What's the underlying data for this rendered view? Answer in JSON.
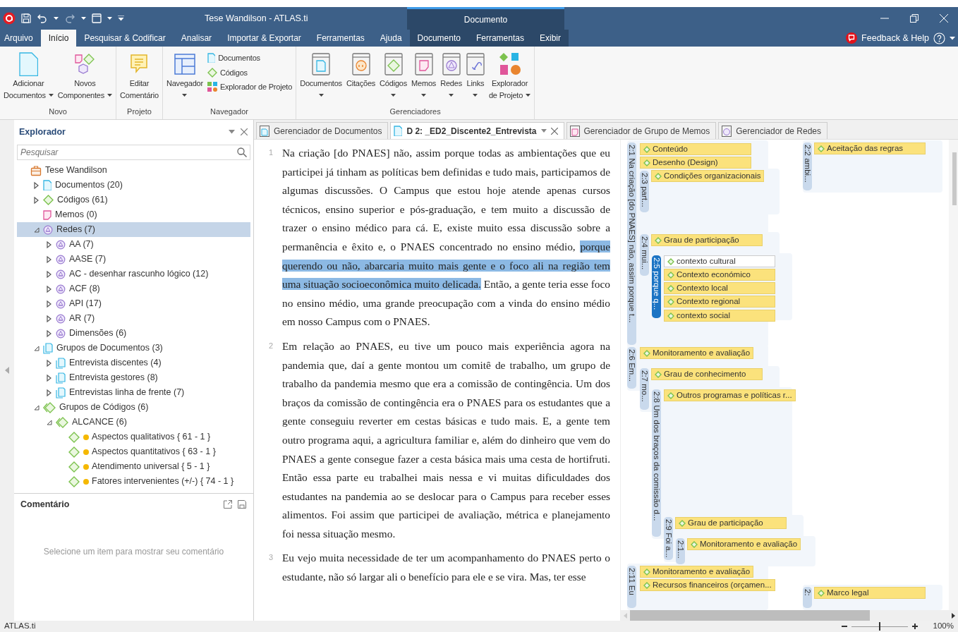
{
  "window": {
    "title": "Tese Wandilson - ATLAS.ti",
    "context_title": "Documento"
  },
  "menu_tabs": [
    {
      "label": "Arquivo",
      "selected": false,
      "context": false
    },
    {
      "label": "Início",
      "selected": true,
      "context": false
    },
    {
      "label": "Pesquisar & Codificar",
      "selected": false,
      "context": false
    },
    {
      "label": "Analisar",
      "selected": false,
      "context": false
    },
    {
      "label": "Importar & Exportar",
      "selected": false,
      "context": false
    },
    {
      "label": "Ferramentas",
      "selected": false,
      "context": false
    },
    {
      "label": "Ajuda",
      "selected": false,
      "context": false
    },
    {
      "label": "Documento",
      "selected": false,
      "context": true
    },
    {
      "label": "Ferramentas",
      "selected": false,
      "context": true
    },
    {
      "label": "Exibir",
      "selected": false,
      "context": true
    }
  ],
  "feedback": "Feedback & Help",
  "ribbon": {
    "groups": [
      {
        "label": "Novo",
        "buttons": [
          {
            "kind": "large",
            "lines": [
              "Adicionar",
              "Documentos"
            ],
            "dropdown": true
          },
          {
            "kind": "large",
            "lines": [
              "Novos",
              "Componentes"
            ],
            "dropdown": true
          }
        ]
      },
      {
        "label": "Projeto",
        "buttons": [
          {
            "kind": "large",
            "lines": [
              "Editar",
              "Comentário"
            ],
            "dropdown": false
          }
        ]
      },
      {
        "label": "Navegador",
        "buttons": [
          {
            "kind": "large",
            "lines": [
              "Navegador"
            ],
            "dropdown": true
          },
          {
            "kind": "small",
            "lines": [
              "Documentos"
            ]
          },
          {
            "kind": "small",
            "lines": [
              "Códigos"
            ]
          },
          {
            "kind": "small",
            "lines": [
              "Explorador de Projeto"
            ]
          }
        ]
      },
      {
        "label": "Gerenciadores",
        "buttons": [
          {
            "kind": "large",
            "lines": [
              "Documentos"
            ],
            "dropdown": true
          },
          {
            "kind": "large",
            "lines": [
              "Citações"
            ],
            "dropdown": false
          },
          {
            "kind": "large",
            "lines": [
              "Códigos"
            ],
            "dropdown": true
          },
          {
            "kind": "large",
            "lines": [
              "Memos"
            ],
            "dropdown": true
          },
          {
            "kind": "large",
            "lines": [
              "Redes"
            ],
            "dropdown": true
          },
          {
            "kind": "large",
            "lines": [
              "Links"
            ],
            "dropdown": true
          },
          {
            "kind": "large",
            "lines": [
              "Explorador",
              "de Projeto"
            ],
            "dropdown": true
          }
        ]
      }
    ]
  },
  "explorer": {
    "title": "Explorador",
    "search": {
      "placeholder": "Pesquisar"
    },
    "tree": [
      {
        "label": "Tese Wandilson",
        "kind": "project",
        "selected": false,
        "children": [
          {
            "label": "Documentos (20)",
            "kind": "document",
            "expanded": false,
            "selected": false
          },
          {
            "label": "Códigos (61)",
            "kind": "code",
            "expanded": false,
            "selected": false
          },
          {
            "label": "Memos (0)",
            "kind": "memo",
            "selected": false
          },
          {
            "label": "Redes (7)",
            "kind": "network",
            "expanded": true,
            "selected": true,
            "children": [
              {
                "label": "AA (7)",
                "kind": "network",
                "expanded": false,
                "selected": false
              },
              {
                "label": "AASE (7)",
                "kind": "network",
                "expanded": false,
                "selected": false
              },
              {
                "label": "AC - desenhar rascunho lógico (12)",
                "kind": "network",
                "expanded": false,
                "selected": false
              },
              {
                "label": "ACF (8)",
                "kind": "network",
                "expanded": false,
                "selected": false
              },
              {
                "label": "API (17)",
                "kind": "network",
                "expanded": false,
                "selected": false
              },
              {
                "label": "AR (7)",
                "kind": "network",
                "expanded": false,
                "selected": false
              },
              {
                "label": "Dimensões (6)",
                "kind": "network",
                "expanded": false,
                "selected": false
              }
            ]
          },
          {
            "label": "Grupos de Documentos (3)",
            "kind": "document-group",
            "expanded": true,
            "selected": false,
            "children": [
              {
                "label": "Entrevista discentes (4)",
                "kind": "document-group",
                "expanded": false,
                "selected": false
              },
              {
                "label": "Entrevista gestores (8)",
                "kind": "document-group",
                "expanded": false,
                "selected": false
              },
              {
                "label": "Entrevistas linha de frente (7)",
                "kind": "document-group",
                "expanded": false,
                "selected": false
              }
            ]
          },
          {
            "label": "Grupos de Códigos (6)",
            "kind": "code-group",
            "expanded": true,
            "selected": false,
            "children": [
              {
                "label": "ALCANCE (6)",
                "kind": "code-group",
                "expanded": true,
                "selected": false,
                "children": [
                  {
                    "label": "Aspectos qualitativos  { 61 - 1 }",
                    "kind": "code-item",
                    "selected": false
                  },
                  {
                    "label": "Aspectos quantitativos  { 63 - 1 }",
                    "kind": "code-item",
                    "selected": false
                  },
                  {
                    "label": "Atendimento universal  { 5 - 1 }",
                    "kind": "code-item",
                    "selected": false
                  },
                  {
                    "label": "Fatores intervenientes (+/-)  { 74 - 1 }",
                    "kind": "code-item",
                    "selected": false
                  }
                ]
              }
            ]
          }
        ]
      }
    ]
  },
  "comment": {
    "title": "Comentário",
    "placeholder": "Selecione um item para mostrar seu comentário"
  },
  "doc_tabs": [
    {
      "label": "Gerenciador de Documentos",
      "kind": "document-manager",
      "selected": false
    },
    {
      "label": "D 2: _ED2_Discente2_Entrevista",
      "kind": "document",
      "selected": true
    },
    {
      "label": "Gerenciador de Grupo de Memos",
      "kind": "memo-group-manager",
      "selected": false
    },
    {
      "label": "Gerenciador de Redes",
      "kind": "network-manager",
      "selected": false
    }
  ],
  "document": {
    "paragraphs": [
      {
        "number": "1",
        "segments": [
          {
            "text": "Na criação [do PNAES] não, assim porque todas as ambientações que eu participei já tinham as políticas bem definidas e tudo mais, participamos de algumas discussões. O Campus que estou hoje atende apenas cursos técnicos, ensino superior e pós-graduação, e tem muito a discussão de trazer o ensino médico para cá. E, existe muito essa discussão sobre a permanência e êxito e, o PNAES concentrado no ensino médio, ",
            "highlighted": false
          },
          {
            "text": "porque querendo ou não, abarcaria muito mais gente e o foco ali na região tem uma situação socioeconômica muito delicada.",
            "highlighted": true
          },
          {
            "text": " Então, a gente teria esse foco no ensino médio, uma grande preocupação com a vinda do ensino médio em nosso Campus com o PNAES.",
            "highlighted": false
          }
        ]
      },
      {
        "number": "2",
        "segments": [
          {
            "text": "Em relação ao PNAES, eu tive um pouco mais experiência agora na pandemia que, daí a gente montou um comitê de trabalho, um grupo de trabalho da pandemia mesmo que era a comissão de contingência. Um dos braços da comissão de contingência era o PNAES para os estudantes que a gente conseguiu reverter em cestas básicas e tudo mais. E, a gente tem outro programa aqui, a agricultura familiar e, além do dinheiro que vem do PNAES a gente consegue fazer a cesta básica mais uma cesta de hortifruti. Então essa parte eu trabalhei mais nessa e vi muitas dificuldades dos estudantes na pandemia ao se deslocar para o Campus para receber esses alimentos. Foi assim que participei de avaliação, métrica e planejamento foi nessa situação mesmo.",
            "highlighted": false
          }
        ]
      },
      {
        "number": "3",
        "segments": [
          {
            "text": "Eu vejo muita necessidade de ter um acompanhamento do PNAES perto o estudante, não só largar ali o benefício para ele e se vira. Mas, ter esse",
            "highlighted": false
          }
        ]
      }
    ]
  },
  "margin": {
    "quotations": [
      {
        "label": "2:1 Na criação [do PNAES] não, assim porque t...",
        "selected": false,
        "codes": [
          {
            "label": "Conteúdo",
            "selected": false
          },
          {
            "label": "Desenho (Design)",
            "selected": false
          }
        ]
      },
      {
        "label": "2:3 part...",
        "selected": false,
        "codes": [
          {
            "label": "Condições organizacionais",
            "selected": false
          }
        ]
      },
      {
        "label": "2:2 ambi...",
        "selected": false,
        "codes": [
          {
            "label": "Aceitação das regras",
            "selected": false
          }
        ]
      },
      {
        "label": "2:4 mui...",
        "selected": false,
        "codes": [
          {
            "label": "Grau de participação",
            "selected": false
          }
        ]
      },
      {
        "label": "2:5 porque q...",
        "selected": true,
        "codes": [
          {
            "label": "contexto cultural",
            "selected": true
          },
          {
            "label": "Contexto económico",
            "selected": false
          },
          {
            "label": "Contexto local",
            "selected": false
          },
          {
            "label": "Contexto regional",
            "selected": false
          },
          {
            "label": "contexto social",
            "selected": false
          }
        ]
      },
      {
        "label": "2:6 Em...",
        "selected": false,
        "codes": [
          {
            "label": "Monitoramento e avaliação",
            "selected": false
          }
        ]
      },
      {
        "label": "2:7 mo...",
        "selected": false,
        "codes": [
          {
            "label": "Grau de conhecimento",
            "selected": false
          }
        ]
      },
      {
        "label": "2:8 Um dos braços da comissão d...",
        "selected": false,
        "codes": [
          {
            "label": "Outros programas e políticas r...",
            "selected": false
          }
        ]
      },
      {
        "label": "2:9 Foi a...",
        "selected": false,
        "codes": [
          {
            "label": "Grau de participação",
            "selected": false
          }
        ]
      },
      {
        "label": "2:1...",
        "selected": false,
        "codes": [
          {
            "label": "Monitoramento e avaliação",
            "selected": false
          }
        ]
      },
      {
        "label": "2:11 Eu",
        "selected": false,
        "codes": [
          {
            "label": "Monitoramento e avaliação",
            "selected": false
          },
          {
            "label": "Recursos financeiros (orçamen...",
            "selected": false
          }
        ]
      },
      {
        "label": "2:",
        "selected": false,
        "codes": [
          {
            "label": "Marco legal",
            "selected": false
          }
        ]
      }
    ]
  },
  "status_bar": {
    "app": "ATLAS.ti",
    "zoom": {
      "level": 0.5,
      "reading": "100%"
    }
  }
}
